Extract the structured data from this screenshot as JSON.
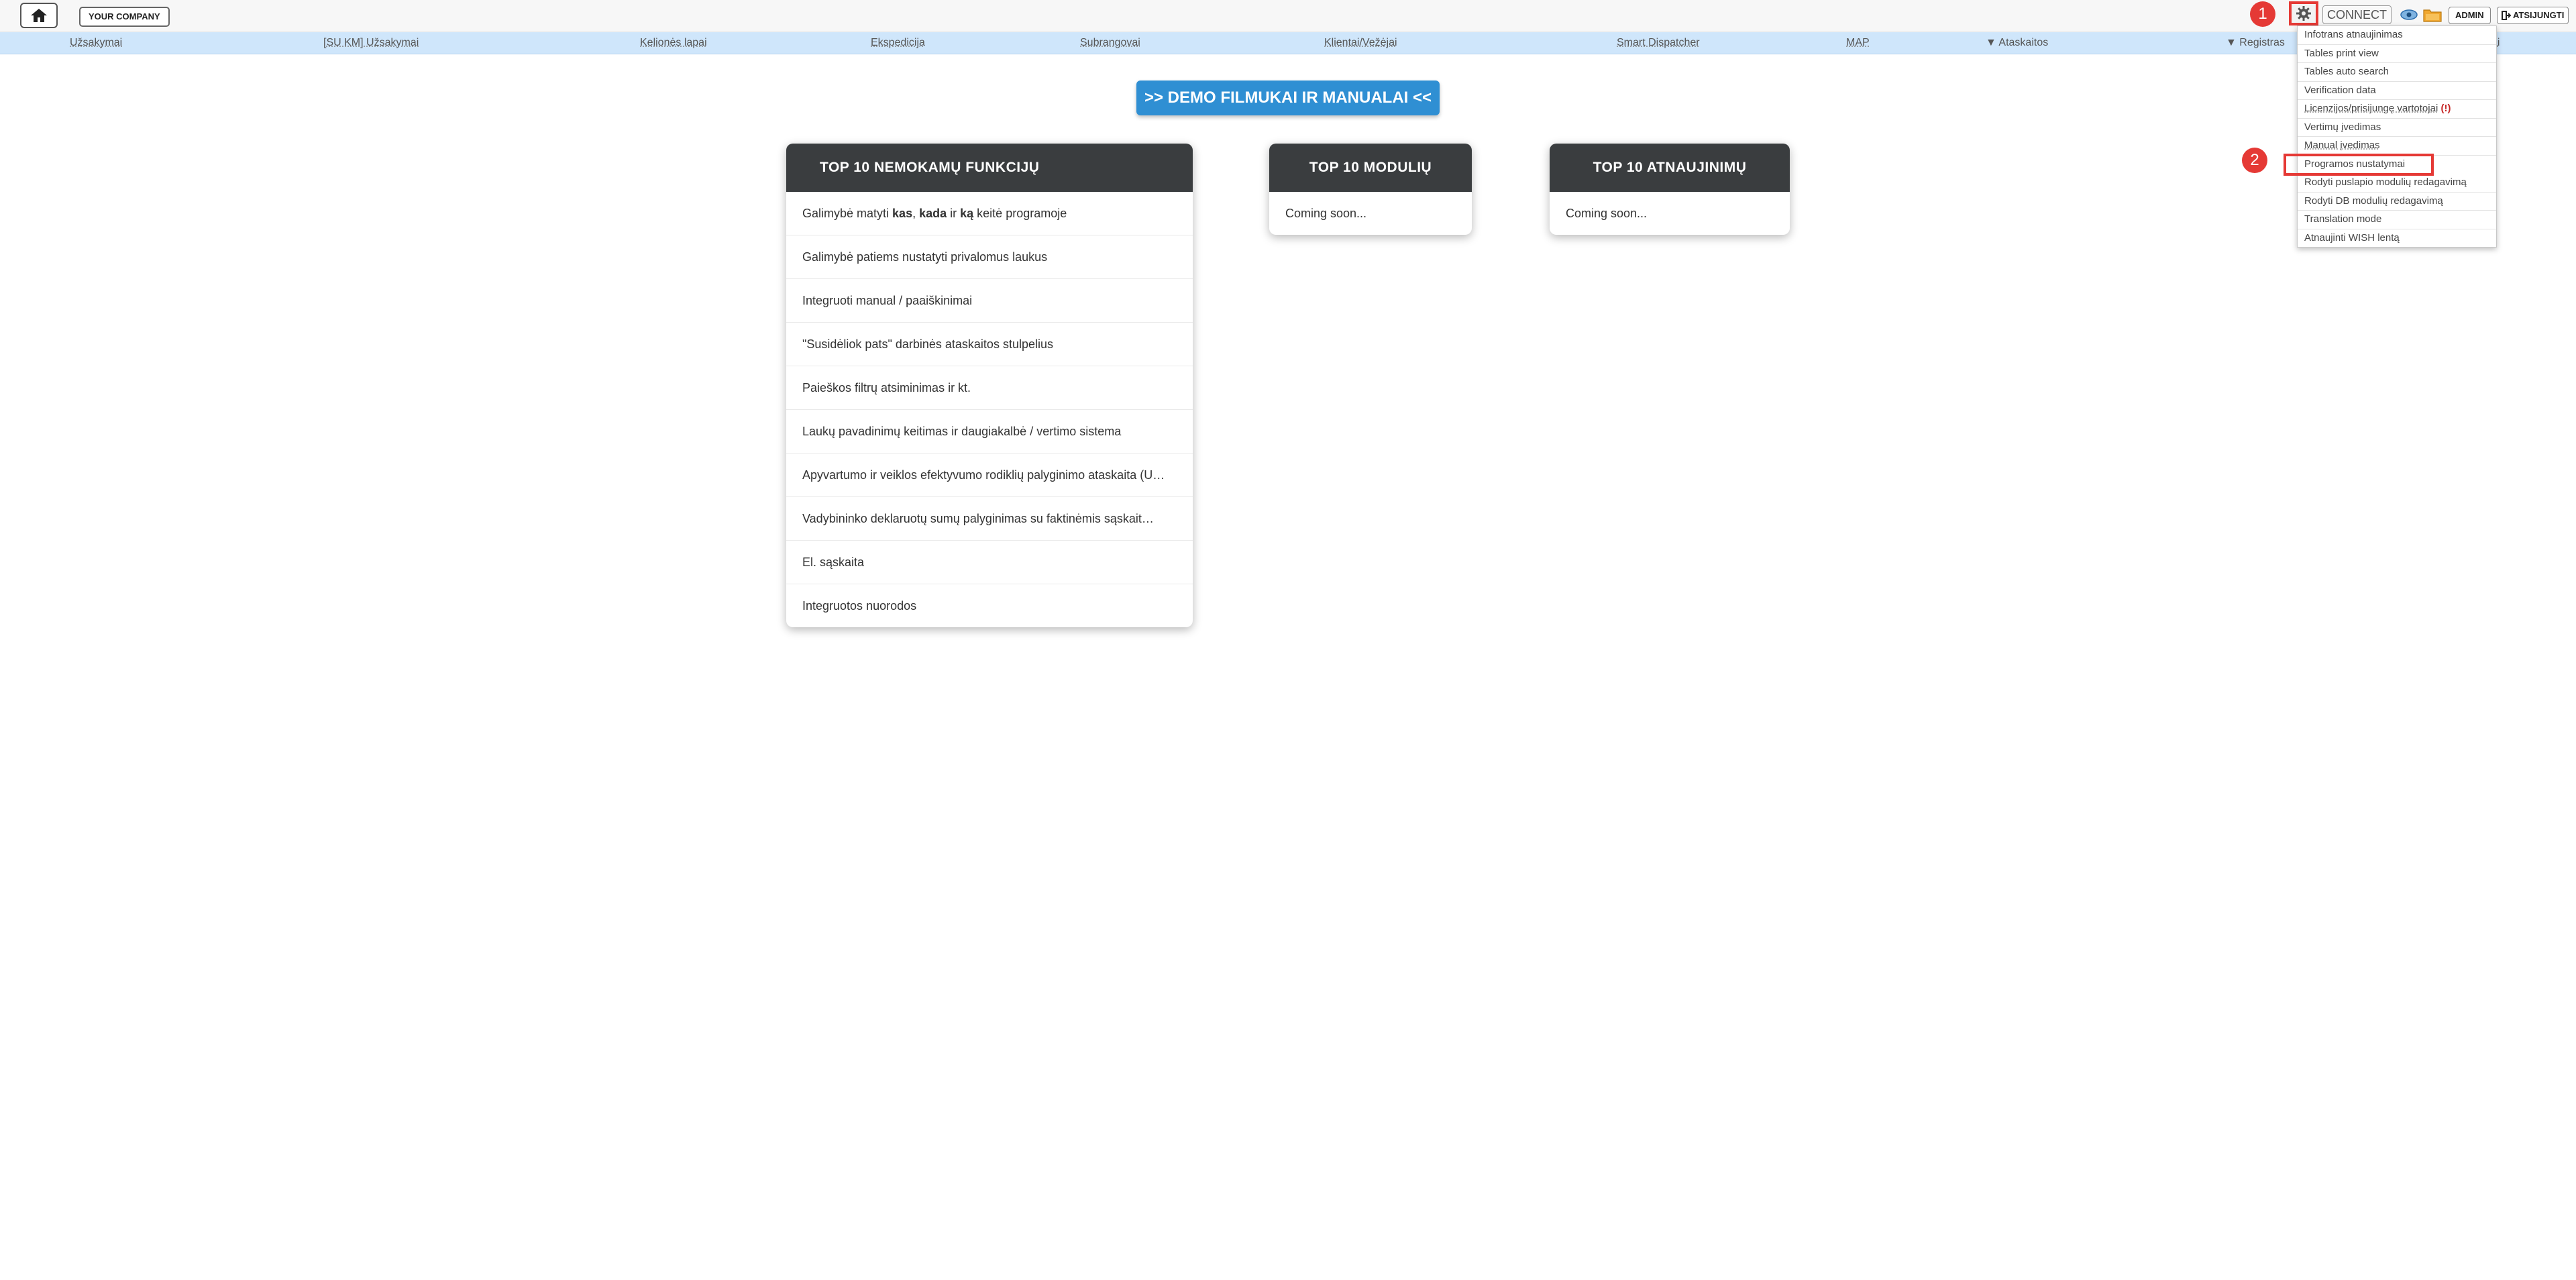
{
  "topbar": {
    "company_label": "YOUR COMPANY",
    "connect_label": "CONNECT",
    "admin_label": "ADMIN",
    "logout_label": "ATSIJUNGTI",
    "icons": {
      "home": "home-icon",
      "settings": "gear-icon",
      "view": "eye-icon",
      "files": "folder-icon",
      "logout": "logout-icon"
    }
  },
  "nav": {
    "items": [
      "Užsakymai",
      "[SU KM] Užsakymai",
      "Kelionės lapai",
      "Ekspedicija",
      "Subrangovai",
      "Klientai/Vežėjai",
      "Smart Dispatcher",
      "MAP",
      "▼ Ataskaitos",
      "▼ Registras",
      "ai"
    ]
  },
  "demo_button": ">> DEMO FILMUKAI IR MANUALAI <<",
  "cards": {
    "features": {
      "title": "TOP 10 NEMOKAMŲ FUNKCIJŲ",
      "first_item": {
        "pre": "Galimybė matyti ",
        "b1": "kas",
        "sep1": ", ",
        "b2": "kada",
        "mid": " ir ",
        "b3": "ką",
        "post": " keitė programoje"
      },
      "items": [
        "Galimybė patiems nustatyti privalomus laukus",
        "Integruoti manual / paaiškinimai",
        "\"Susidėliok pats\" darbinės ataskaitos stulpelius",
        "Paieškos filtrų atsiminimas ir kt.",
        "Laukų pavadinimų keitimas ir daugiakalbė / vertimo sistema",
        "Apyvartumo ir veiklos efektyvumo rodiklių palyginimo ataskaita (U…",
        "Vadybininko deklaruotų sumų palyginimas su faktinėmis sąskait…",
        "El. sąskaita",
        "Integruotos nuorodos"
      ]
    },
    "modules": {
      "title": "TOP 10 MODULIŲ",
      "item": "Coming soon..."
    },
    "updates": {
      "title": "TOP 10 ATNAUJINIMŲ",
      "item": "Coming soon..."
    }
  },
  "settings_menu": {
    "items": [
      "Infotrans atnaujinimas",
      "Tables print view",
      "Tables auto search",
      "Verification data",
      "Licenzijos/prisijungę vartotojai",
      "Vertimų įvedimas",
      "Manual įvedimas",
      "Programos nustatymai",
      "Rodyti puslapio modulių redagavimą",
      "Rodyti DB modulių redagavimą",
      "Translation mode",
      "Atnaujinti WISH lentą"
    ],
    "warning_mark": "(!)"
  },
  "markers": {
    "one": "1",
    "two": "2"
  },
  "colors": {
    "accent_red": "#e53935",
    "demo_blue": "#2f8fd3",
    "nav_blue": "#cfe6fb",
    "card_header": "#3a3d3f"
  }
}
